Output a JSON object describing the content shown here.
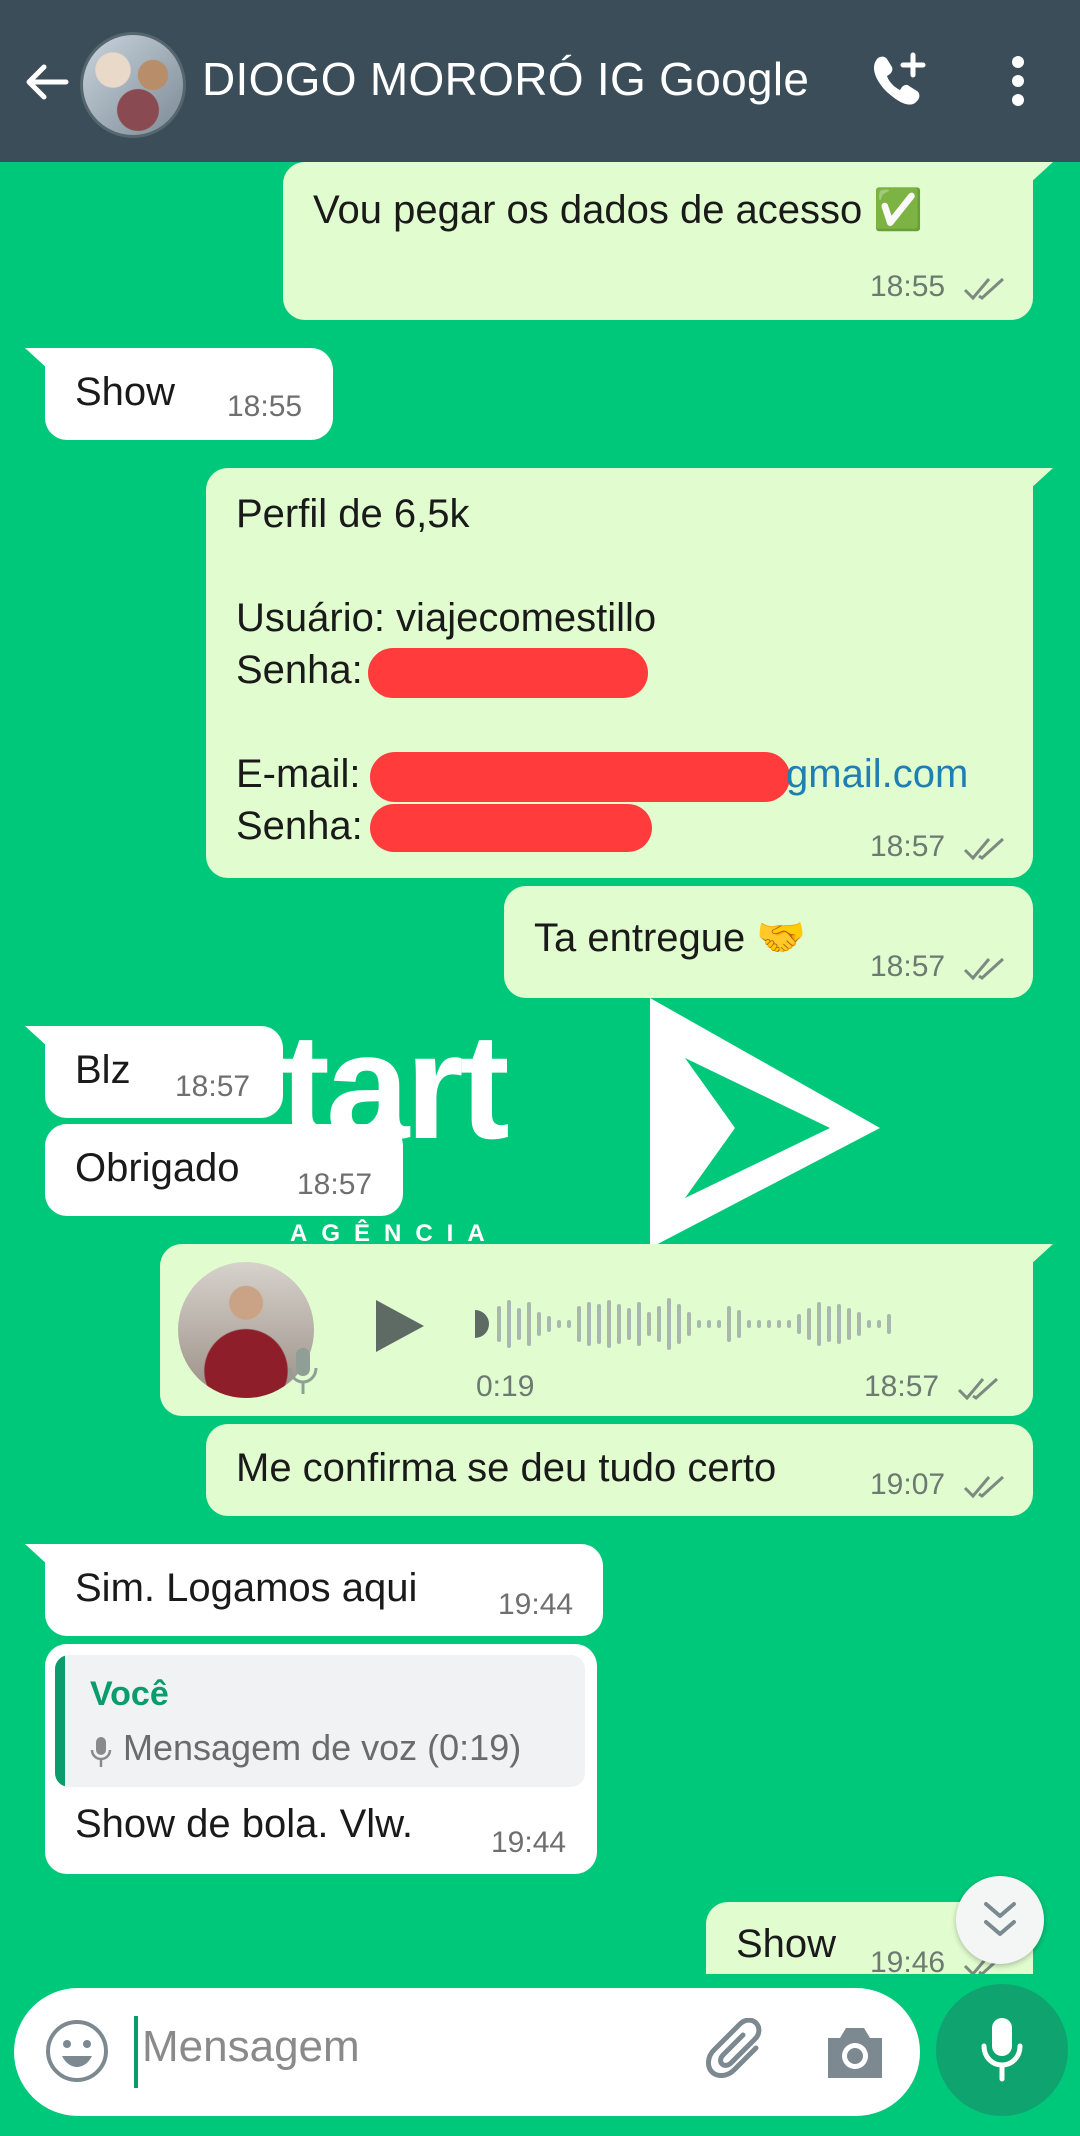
{
  "header": {
    "contact_name": "DIOGO MORORÓ IG Google"
  },
  "watermark": {
    "text": "tart",
    "subtext": "AGÊNCIA"
  },
  "messages": [
    {
      "dir": "out",
      "text": "Vou pegar os dados de acesso ✅",
      "time": "18:55",
      "status": "read"
    },
    {
      "dir": "in",
      "text": "Show",
      "time": "18:55"
    },
    {
      "dir": "out",
      "lines": [
        "Perfil de 6,5k",
        "Usuário: viajecomestillo",
        "Senha:",
        "E-mail:",
        "gmail.com",
        "Senha:"
      ],
      "time": "18:57",
      "status": "read"
    },
    {
      "dir": "out",
      "text": "Ta entregue 🤝",
      "time": "18:57",
      "status": "read"
    },
    {
      "dir": "in",
      "text": "Blz",
      "time": "18:57"
    },
    {
      "dir": "in",
      "text": "Obrigado",
      "time": "18:57"
    },
    {
      "dir": "out",
      "type": "voice",
      "duration": "0:19",
      "time": "18:57",
      "status": "read"
    },
    {
      "dir": "out",
      "text": "Me confirma se deu tudo certo",
      "time": "19:07",
      "status": "read"
    },
    {
      "dir": "in",
      "text": "Sim. Logamos aqui",
      "time": "19:44"
    },
    {
      "dir": "in",
      "reply_to": {
        "author": "Você",
        "text": "Mensagem de voz (0:19)"
      },
      "text": "Show de bola. Vlw.",
      "time": "19:44"
    },
    {
      "dir": "out",
      "text": "Show",
      "time": "19:46",
      "status": "read"
    }
  ],
  "composer": {
    "placeholder": "Mensagem"
  },
  "icons": {
    "back": "arrow-left-icon",
    "call": "phone-plus-icon",
    "more": "more-vertical-icon",
    "emoji": "emoji-icon",
    "attach": "paperclip-icon",
    "camera": "camera-icon",
    "mic": "mic-icon",
    "scroll": "chevrons-down-icon",
    "ticks": "double-check-icon"
  },
  "colors": {
    "header": "#3b4d58",
    "wallpaper": "#00c87a",
    "outgoing": "#e1fccf",
    "incoming": "#ffffff",
    "accent": "#0fa46f"
  }
}
